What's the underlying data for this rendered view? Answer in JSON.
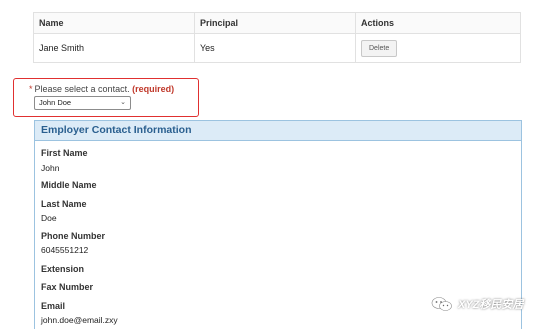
{
  "table": {
    "headers": {
      "name": "Name",
      "principal": "Principal",
      "actions": "Actions"
    },
    "rows": [
      {
        "name": "Jane Smith",
        "principal": "Yes",
        "action_label": "Delete"
      }
    ]
  },
  "select_contact": {
    "star": "*",
    "label": "Please select a contact.",
    "required": "(required)",
    "value": "John Doe"
  },
  "employer_contact": {
    "title": "Employer Contact Information",
    "fields": [
      {
        "label": "First Name",
        "value": "John"
      },
      {
        "label": "Middle Name",
        "value": ""
      },
      {
        "label": "Last Name",
        "value": "Doe"
      },
      {
        "label": "Phone Number",
        "value": "6045551212"
      },
      {
        "label": "Extension",
        "value": ""
      },
      {
        "label": "Fax Number",
        "value": ""
      },
      {
        "label": "Email",
        "value": "john.doe@email.zxy"
      }
    ]
  },
  "watermark": {
    "text": "XYZ移民安居",
    "icon": "wechat-icon"
  }
}
